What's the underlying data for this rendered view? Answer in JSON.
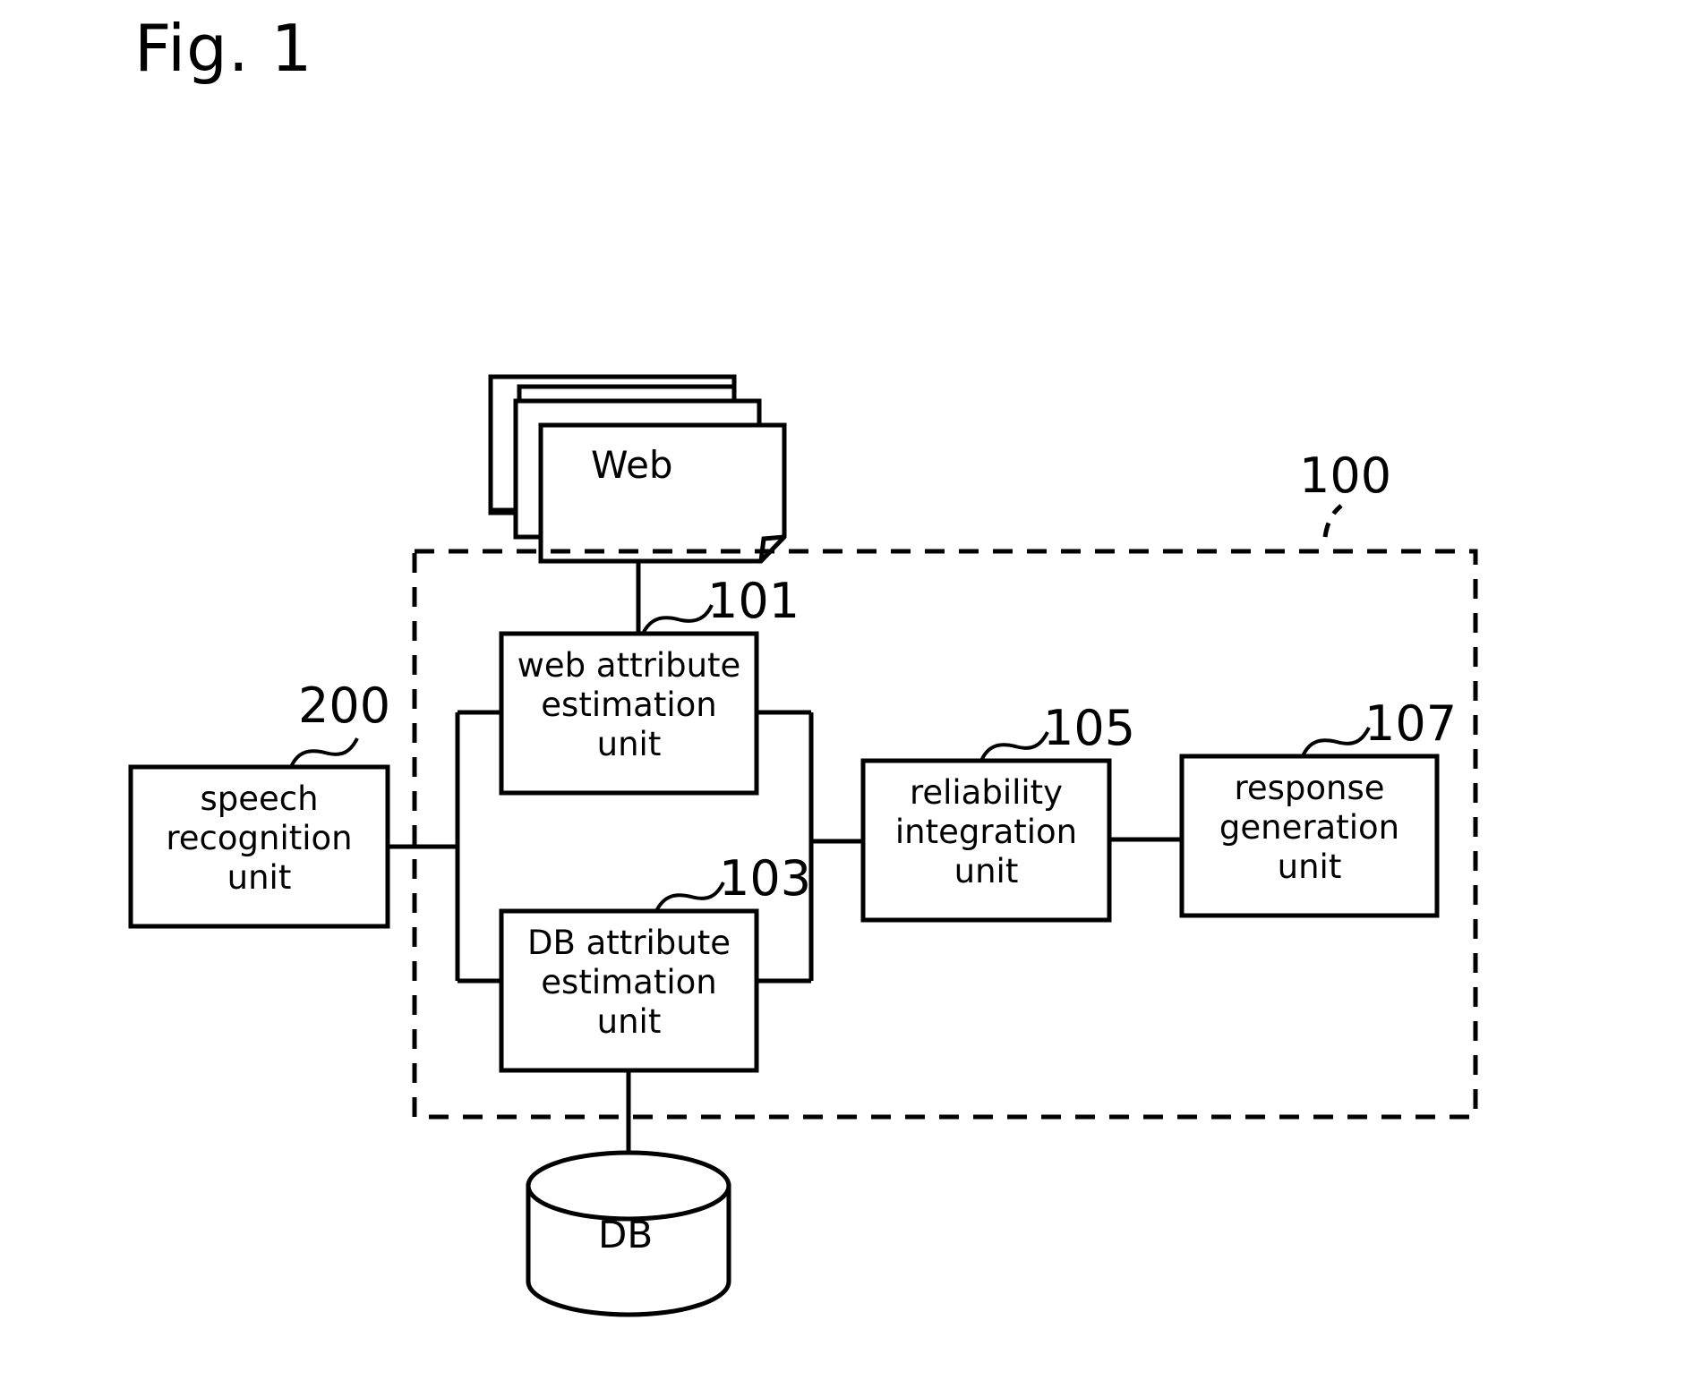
{
  "figure": {
    "title": "Fig. 1",
    "caption_position": "top-left"
  },
  "colors": {
    "stroke": "#000000",
    "background": "#ffffff",
    "text": "#000000"
  },
  "sources": {
    "web": {
      "label": "Web",
      "icon": "document-stack-icon"
    },
    "db": {
      "label": "DB",
      "icon": "database-cylinder-icon"
    }
  },
  "system": {
    "ref": "100",
    "boundary_style": "dashed"
  },
  "blocks": [
    {
      "id": "web-attribute-estimation-unit",
      "ref": "101",
      "lines": [
        "web attribute",
        "estimation",
        "unit"
      ],
      "text": "web attribute\nestimation\nunit"
    },
    {
      "id": "db-attribute-estimation-unit",
      "ref": "103",
      "lines": [
        "DB attribute",
        "estimation",
        "unit"
      ],
      "text": "DB attribute\nestimation\nunit"
    },
    {
      "id": "reliability-integration-unit",
      "ref": "105",
      "lines": [
        "reliability",
        "integration",
        "unit"
      ],
      "text": "reliability\nintegration\nunit"
    },
    {
      "id": "response-generation-unit",
      "ref": "107",
      "lines": [
        "response",
        "generation",
        "unit"
      ],
      "text": "response\ngeneration\nunit"
    },
    {
      "id": "speech-recognition-unit",
      "ref": "200",
      "lines": [
        "speech",
        "recognition",
        "unit"
      ],
      "text": "speech\nrecognition\nunit"
    }
  ],
  "refs": {
    "system": "100",
    "web_attribute": "101",
    "db_attribute": "103",
    "reliability": "105",
    "response": "107",
    "speech": "200"
  }
}
